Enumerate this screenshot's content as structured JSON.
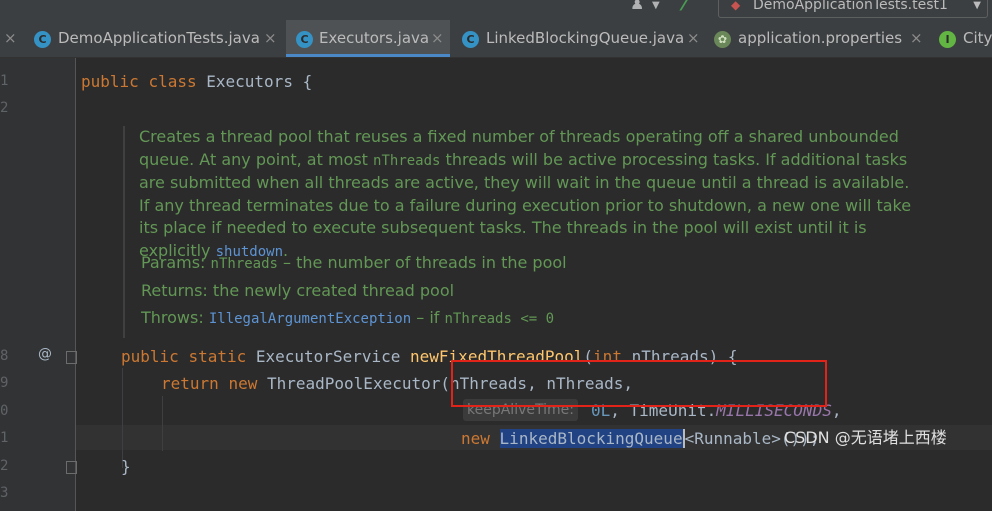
{
  "toolbar": {
    "run_config": "DemoApplicationTests.test1"
  },
  "tabs": [
    {
      "label": "DemoApplicationTests.java",
      "icon": "C",
      "icon_color": "#3592c4",
      "active": false
    },
    {
      "label": "Executors.java",
      "icon": "C",
      "icon_color": "#3592c4",
      "active": true
    },
    {
      "label": "LinkedBlockingQueue.java",
      "icon": "C",
      "icon_color": "#3592c4",
      "active": false
    },
    {
      "label": "application.properties",
      "icon": "spring-leaf",
      "icon_color": "#6a8759",
      "active": false
    },
    {
      "label": "City",
      "icon": "I",
      "icon_color": "#62b543",
      "active": false
    }
  ],
  "gutter": {
    "line_numbers": [
      "1",
      "2",
      "8",
      "9",
      "0",
      "1",
      "2",
      "3"
    ],
    "override_marker": "@"
  },
  "code": {
    "class_kw1": "public",
    "class_kw2": "class",
    "class_name": "Executors",
    "class_brace": " {",
    "method_kw1": "public",
    "method_kw2": "static",
    "method_ret": "ExecutorService",
    "method_name": "newFixedThreadPool",
    "method_open": "(",
    "param_type": "int",
    "method_params_rest": " nThreads) {",
    "return_kw": "return",
    "new_kw": "new",
    "return_rest": " ThreadPoolExecutor(nThreads, nThreads,",
    "keepalive_hint": "keepAliveTime:",
    "keepalive_value": "0L",
    "timeunit_prefix": ", TimeUnit.",
    "timeunit_const": "MILLISECONDS",
    "timeunit_suffix": ",",
    "queue_new_kw": "new",
    "queue_class": "LinkedBlockingQueue",
    "queue_rest": "<Runnable>());",
    "closing_brace": "}"
  },
  "javadoc": {
    "description_1": "Creates a thread pool that reuses a fixed number of threads operating off a shared unbounded queue. At any point, at most ",
    "description_code": "nThreads",
    "description_2": " threads will be active processing tasks. If additional tasks are submitted when all threads are active, they will wait in the queue until a thread is available. If any thread terminates due to a failure during execution prior to shutdown, a new one will take its place if needed to execute subsequent tasks. The threads in the pool will exist until it is explicitly ",
    "description_link": "shutdown",
    "description_end": ".",
    "params_label": "Params:",
    "params_code": "nThreads",
    "params_text": " – the number of threads in the pool",
    "returns_label": "Returns:",
    "returns_text": "the newly created thread pool",
    "throws_label": "Throws:",
    "throws_code": "IllegalArgumentException",
    "throws_text": " – if ",
    "throws_condition": "nThreads <= 0"
  },
  "watermark": "CSDN @无语堵上西楼",
  "colors": {
    "keyword": "#cc7832",
    "method": "#ffc66d",
    "constant": "#9876aa",
    "number": "#6897bb",
    "doc": "#629755",
    "selection": "#214283",
    "highlight_box": "#e2231a"
  }
}
